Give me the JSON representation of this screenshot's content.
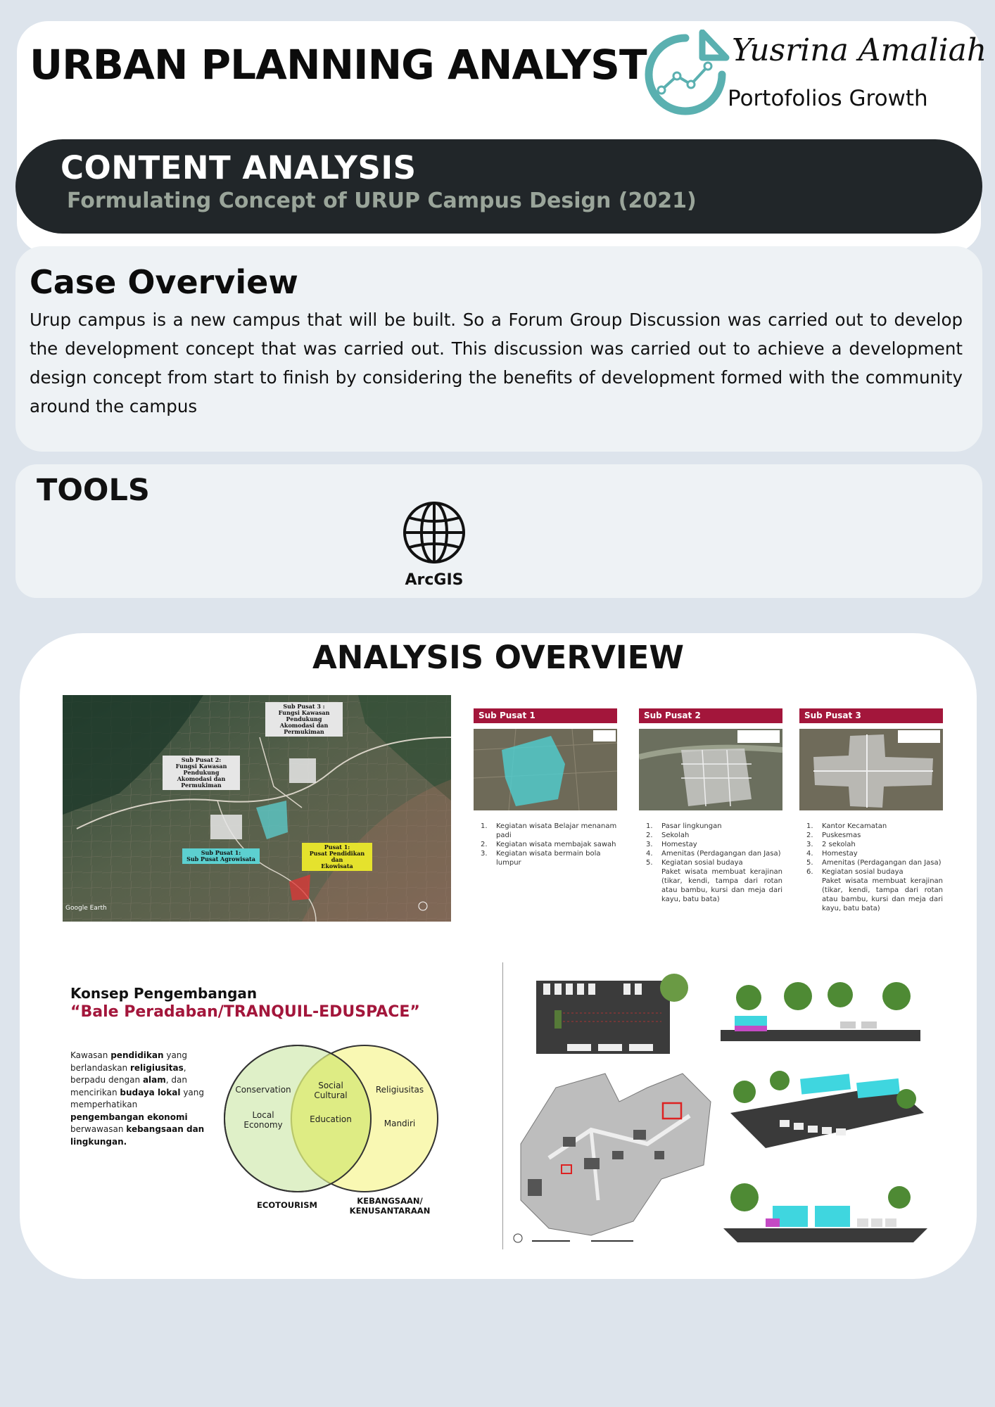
{
  "header": {
    "title": "URBAN PLANNING ANALYST",
    "logo": {
      "signature": "Yusrina Amaliah",
      "tagline": "Portofolios Growth",
      "accent_color": "#5ab0b0"
    }
  },
  "banner": {
    "title": "CONTENT ANALYSIS",
    "subtitle": "Formulating Concept of URUP Campus Design (2021)"
  },
  "case_overview": {
    "title": "Case Overview",
    "body": "Urup campus is a new campus that will be built. So a Forum Group Discussion was carried out to develop the development concept that was carried out. This discussion was carried out to achieve a development design concept from start to finish by considering the benefits of development formed with the community around the campus"
  },
  "tools": {
    "title": "TOOLS",
    "items": [
      {
        "label": "ArcGIS",
        "icon": "globe-icon"
      }
    ]
  },
  "analysis": {
    "title": "ANALYSIS OVERVIEW",
    "map": {
      "labels": {
        "sub3": "Sub Pusat 3 :\nFungsi Kawasan Pendukung\nAkomodasi dan Permukiman",
        "sub2": "Sub Pusat 2:\nFungsi Kawasan Pendukung\nAkomodasi dan Permukiman",
        "sub1": "Sub Pusat 1:\nSub Pusat Agrowisata",
        "pusat1": "Pusat 1:\nPusat Pendidikan dan\nEkowisata"
      },
      "watermark": "Google Earth"
    },
    "sub_panels": [
      {
        "title": "Sub Pusat 1",
        "items": [
          "Kegiatan wisata Belajar menanam padi",
          "Kegiatan wisata membajak sawah",
          "Kegiatan wisata bermain bola lumpur"
        ],
        "note": ""
      },
      {
        "title": "Sub Pusat 2",
        "items": [
          "Pasar lingkungan",
          "Sekolah",
          "Homestay",
          "Amenitas (Perdagangan dan Jasa)",
          "Kegiatan sosial budaya"
        ],
        "note": "Paket wisata membuat kerajinan (tikar, kendi, tampa dari rotan atau bambu, kursi dan meja dari kayu, batu bata)"
      },
      {
        "title": "Sub Pusat 3",
        "items": [
          "Kantor Kecamatan",
          "Puskesmas",
          "2 sekolah",
          "Homestay",
          "Amenitas (Perdagangan dan Jasa)",
          "Kegiatan sosial budaya"
        ],
        "note": "Paket wisata membuat kerajinan (tikar, kendi, tampa dari rotan atau bambu, kursi dan meja dari kayu, batu bata)"
      }
    ],
    "concept": {
      "heading": "Konsep Pengembangan",
      "quote": "“Bale Peradaban/TRANQUIL-EDUSPACE”",
      "venn": {
        "left_top": "Conservation",
        "left_bottom": "Local\nEconomy",
        "center_top": "Social\nCultural",
        "center_bottom": "Education",
        "right_top": "Religiusitas",
        "right_bottom": "Mandiri",
        "foot_left": "ECOTOURISM",
        "foot_right": "KEBANGSAAN/\nKENUSANTARAAN",
        "left_color": "#dff0c8",
        "right_color": "#f8f7a6"
      }
    }
  }
}
